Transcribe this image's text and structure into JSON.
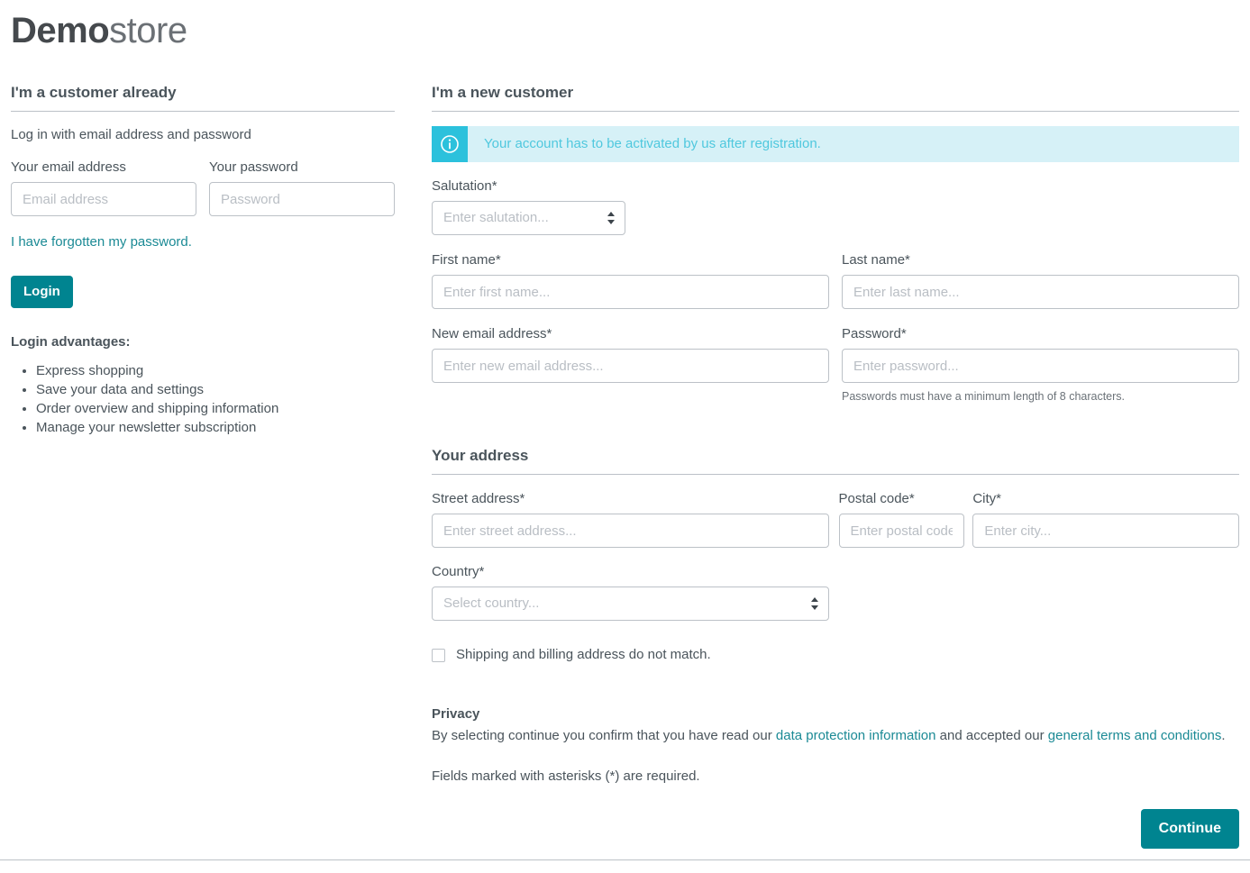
{
  "brand": {
    "name_bold": "Demo",
    "name_light": "store"
  },
  "login": {
    "heading": "I'm a customer already",
    "subtitle": "Log in with email address and password",
    "email_label": "Your email address",
    "email_placeholder": "Email address",
    "email_value": "",
    "password_label": "Your password",
    "password_placeholder": "Password",
    "password_value": "",
    "forgot_link": "I have forgotten my password.",
    "login_button": "Login",
    "advantages_title": "Login advantages:",
    "advantages": [
      "Express shopping",
      "Save your data and settings",
      "Order overview and shipping information",
      "Manage your newsletter subscription"
    ]
  },
  "register": {
    "heading": "I'm a new customer",
    "alert": {
      "icon": "info-circle-icon",
      "message": "Your account has to be activated by us after registration."
    },
    "salutation_label": "Salutation*",
    "salutation_placeholder": "Enter salutation...",
    "first_name_label": "First name*",
    "first_name_placeholder": "Enter first name...",
    "first_name_value": "",
    "last_name_label": "Last name*",
    "last_name_placeholder": "Enter last name...",
    "last_name_value": "",
    "email_label": "New email address*",
    "email_placeholder": "Enter new email address...",
    "email_value": "",
    "password_label": "Password*",
    "password_placeholder": "Enter password...",
    "password_value": "",
    "password_hint": "Passwords must have a minimum length of 8 characters."
  },
  "address": {
    "heading": "Your address",
    "street_label": "Street address*",
    "street_placeholder": "Enter street address...",
    "street_value": "",
    "postal_label": "Postal code*",
    "postal_placeholder": "Enter postal code...",
    "postal_value": "",
    "city_label": "City*",
    "city_placeholder": "Enter city...",
    "city_value": "",
    "country_label": "Country*",
    "country_placeholder": "Select country...",
    "different_shipping_label": "Shipping and billing address do not match.",
    "different_shipping_checked": false
  },
  "privacy": {
    "title": "Privacy",
    "text_before": "By selecting continue you confirm that you have read our ",
    "link_data_protection": "data protection information",
    "text_middle": " and accepted our ",
    "link_terms": "general terms and conditions",
    "text_after": ".",
    "required_note": "Fields marked with asterisks (*) are required."
  },
  "actions": {
    "continue_button": "Continue"
  },
  "colors": {
    "accent_teal": "#008490",
    "link_teal": "#1b8a95",
    "alert_bg": "#d6f1f7",
    "alert_icon_bg": "#2cc1dc",
    "alert_text": "#4fc8de",
    "text": "#4a545b",
    "border": "#bcc1c7"
  }
}
